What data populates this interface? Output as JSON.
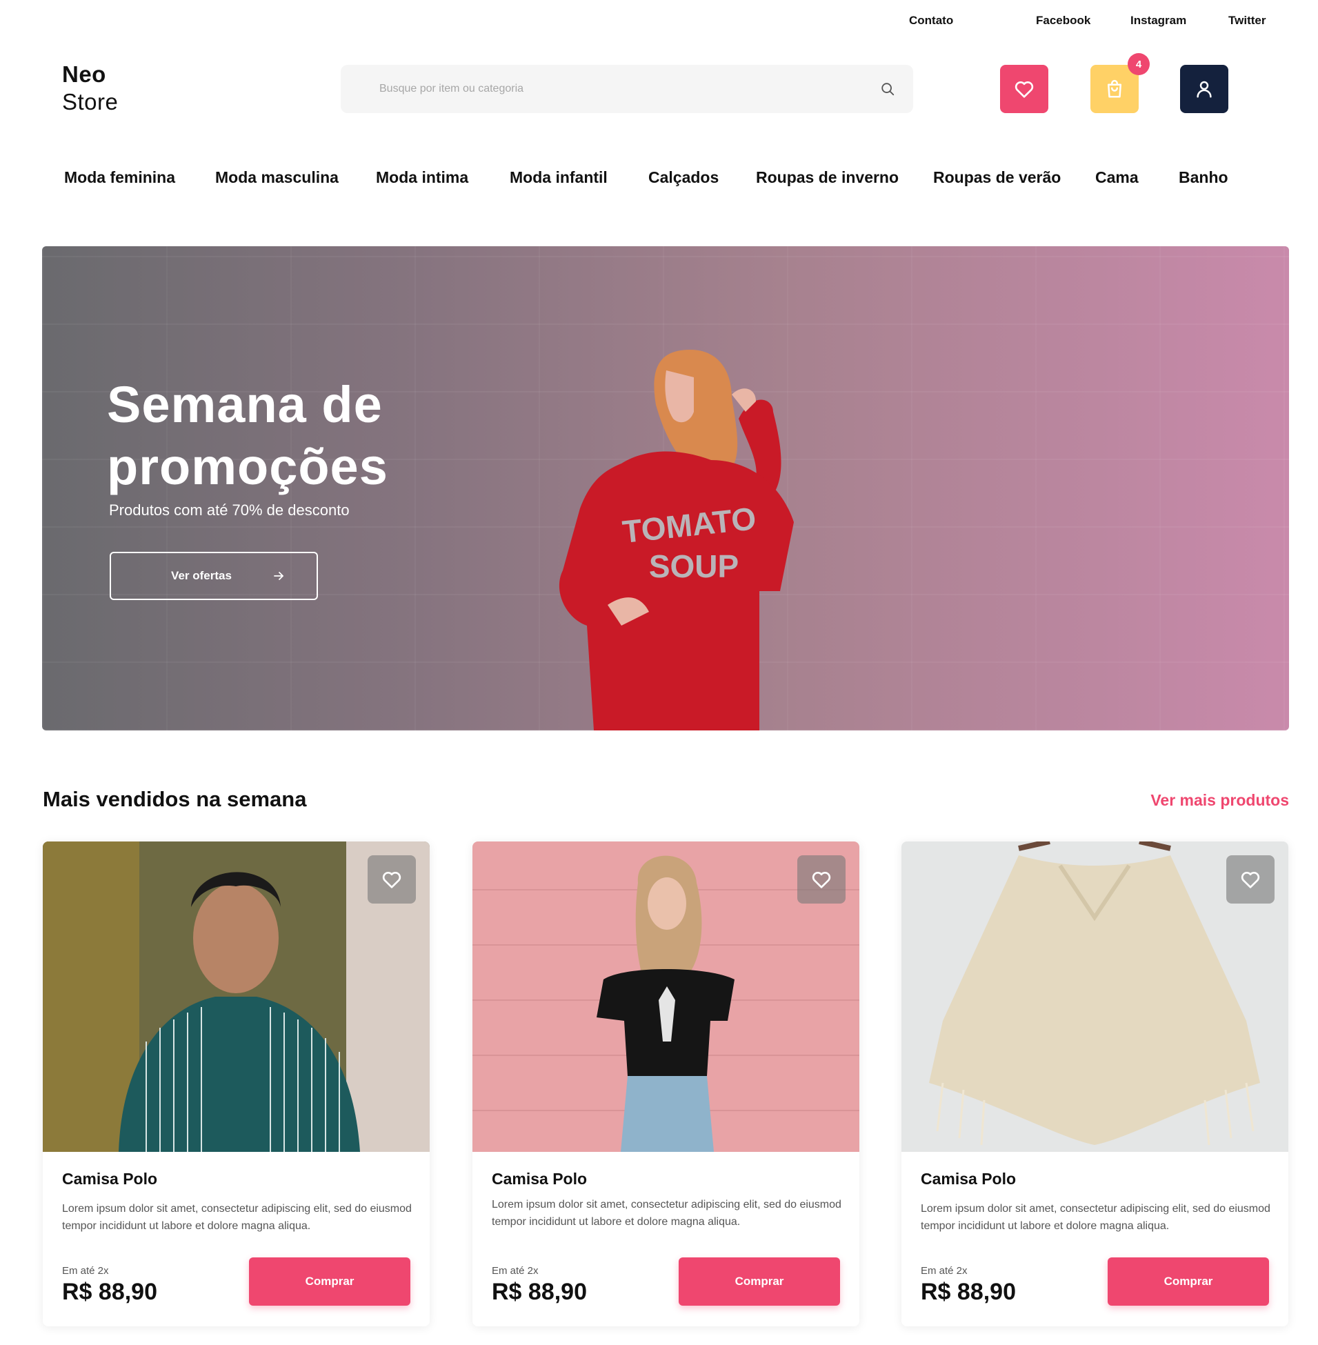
{
  "top_links": [
    "Contato",
    "Facebook",
    "Instagram",
    "Twitter"
  ],
  "logo": {
    "line1": "Neo",
    "line2": "Store"
  },
  "search": {
    "placeholder": "Busque por item ou categoria",
    "icon": "search-icon"
  },
  "header_buttons": {
    "favorites_icon": "heart-icon",
    "cart_icon": "shopping-bag-icon",
    "cart_count": "4",
    "account_icon": "user-icon"
  },
  "categories": [
    "Moda feminina",
    "Moda masculina",
    "Moda intima",
    "Moda infantil",
    "Calçados",
    "Roupas de inverno",
    "Roupas de verão",
    "Cama",
    "Banho"
  ],
  "banner": {
    "title": "Semana de promoções",
    "subtitle": "Produtos com até 70% de desconto",
    "cta_label": "Ver ofertas",
    "cta_icon": "arrow-right-icon"
  },
  "section": {
    "title": "Mais vendidos na semana",
    "link": "Ver mais produtos"
  },
  "products": [
    {
      "name": "Camisa Polo",
      "description": "Lorem ipsum dolor sit amet, consectetur adipiscing elit, sed do eiusmod tempor incididunt ut labore et dolore magna aliqua.",
      "installments": "Em até 2x",
      "price": "R$ 88,90",
      "button": "Comprar"
    },
    {
      "name": "Camisa Polo",
      "description": "Lorem ipsum dolor sit amet, consectetur adipiscing elit, sed do eiusmod tempor incididunt ut labore et dolore magna aliqua.",
      "installments": "Em até 2x",
      "price": "R$ 88,90",
      "button": "Comprar"
    },
    {
      "name": "Camisa Polo",
      "description": "Lorem ipsum dolor sit amet, consectetur adipiscing elit, sed do eiusmod tempor incididunt ut labore et dolore magna aliqua.",
      "installments": "Em até 2x",
      "price": "R$ 88,90",
      "button": "Comprar"
    }
  ],
  "colors": {
    "accent": "#ef476f",
    "cart": "#ffd166",
    "account": "#14213d"
  }
}
